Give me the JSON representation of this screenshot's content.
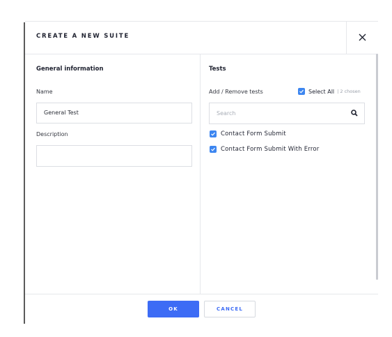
{
  "dialog": {
    "title": "CREATE A NEW SUITE",
    "close_icon": "close-icon"
  },
  "general": {
    "section_title": "General information",
    "name_label": "Name",
    "name_value": "General Test",
    "description_label": "Description",
    "description_value": ""
  },
  "tests": {
    "section_title": "Tests",
    "add_remove_label": "Add / Remove tests",
    "select_all_label": "Select All",
    "chosen_text": "| 2 chosen",
    "search_placeholder": "Search",
    "search_icon": "search-icon",
    "items": [
      {
        "label": "Contact Form Submit",
        "checked": true
      },
      {
        "label": "Contact Form Submit With Error",
        "checked": true
      }
    ]
  },
  "footer": {
    "ok_label": "OK",
    "cancel_label": "CANCEL"
  },
  "colors": {
    "primary": "#3d6cf5",
    "checkbox": "#3d86f0",
    "border": "#e6e7eb"
  }
}
